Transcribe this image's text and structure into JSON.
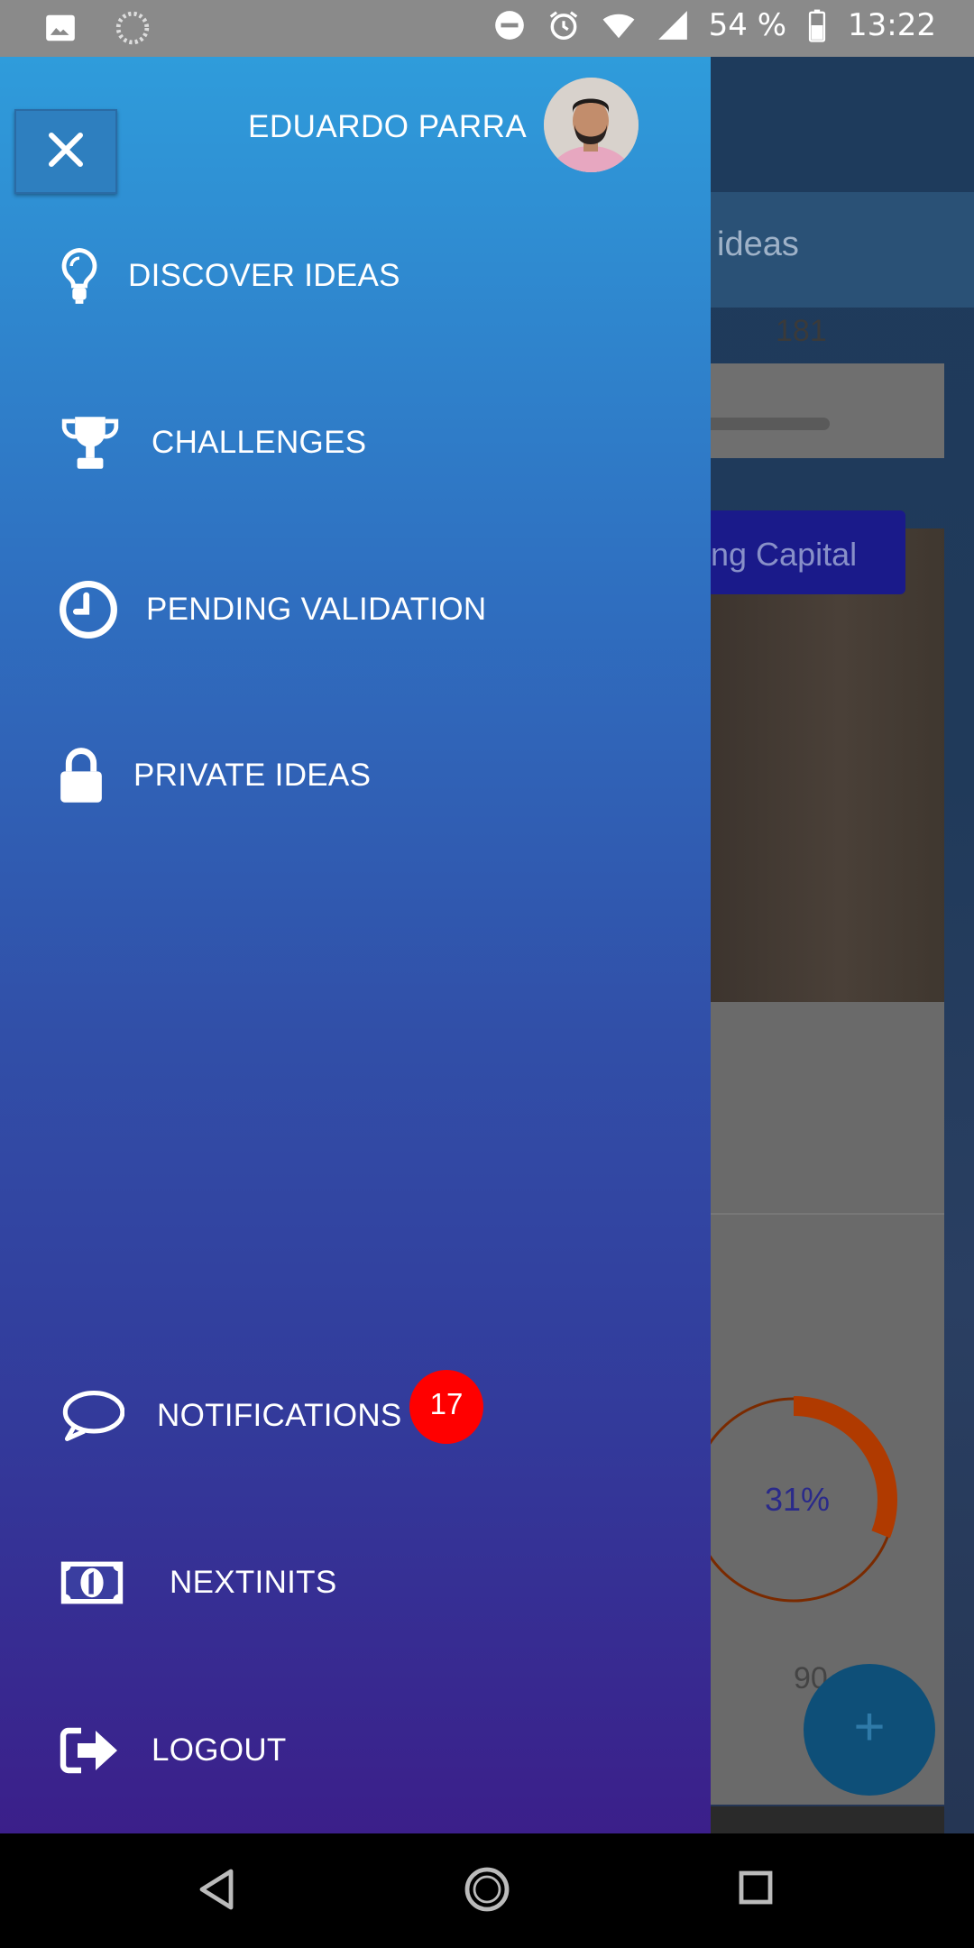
{
  "status_bar": {
    "battery": "54 %",
    "time": "13:22"
  },
  "drawer": {
    "user_name": "EDUARDO PARRA",
    "menu": [
      {
        "label": "DISCOVER IDEAS",
        "icon": "lightbulb-icon"
      },
      {
        "label": "CHALLENGES",
        "icon": "trophy-icon"
      },
      {
        "label": "PENDING VALIDATION",
        "icon": "clock-icon"
      },
      {
        "label": "PRIVATE IDEAS",
        "icon": "lock-icon"
      }
    ],
    "bottom_menu": [
      {
        "label": "NOTIFICATIONS",
        "icon": "speech-bubble-icon",
        "badge": "17"
      },
      {
        "label": "NEXTINITS",
        "icon": "banknote-icon"
      },
      {
        "label": "LOGOUT",
        "icon": "logout-icon"
      }
    ]
  },
  "background_app": {
    "header_text": "ideas",
    "card_count": "181",
    "chip_text": "ing Capital",
    "progress_label": "31%",
    "progress_value": 0.31,
    "small_number": "90",
    "fab_label": "+"
  },
  "colors": {
    "drawer_top": "#2f9cdb",
    "drawer_bottom": "#3b1f8a",
    "badge": "#ff0000",
    "donut_accent": "#c04000"
  }
}
